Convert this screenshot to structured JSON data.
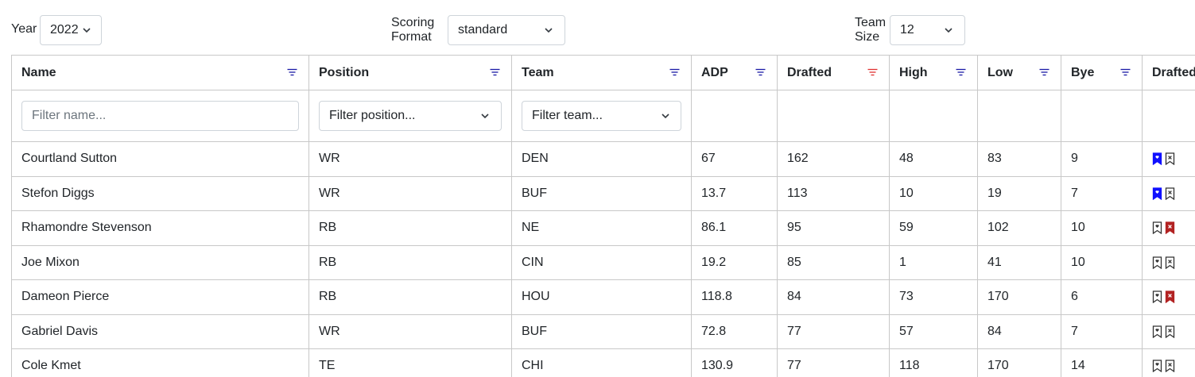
{
  "controls": {
    "year": {
      "label": "Year",
      "value": "2022"
    },
    "scoring": {
      "label_line1": "Scoring",
      "label_line2": "Format",
      "value": "standard"
    },
    "team_size": {
      "label_line1": "Team",
      "label_line2": "Size",
      "value": "12"
    }
  },
  "columns": [
    {
      "label": "Name",
      "filter_active": false
    },
    {
      "label": "Position",
      "filter_active": false
    },
    {
      "label": "Team",
      "filter_active": false
    },
    {
      "label": "ADP",
      "filter_active": false
    },
    {
      "label": "Drafted",
      "filter_active": true
    },
    {
      "label": "High",
      "filter_active": false
    },
    {
      "label": "Low",
      "filter_active": false
    },
    {
      "label": "Bye",
      "filter_active": false
    },
    {
      "label": "Drafted",
      "filter_active": false
    }
  ],
  "filters": {
    "name_placeholder": "Filter name...",
    "position_placeholder": "Filter position...",
    "team_placeholder": "Filter team..."
  },
  "colors": {
    "accent_blue": "#1010ff",
    "accent_red": "#b22222",
    "filter_icon": "#1a1aa6",
    "filter_icon_active": "#e03030"
  },
  "rows": [
    {
      "name": "Courtland Sutton",
      "position": "WR",
      "team": "DEN",
      "adp": "67",
      "drafted": "162",
      "high": "48",
      "low": "83",
      "bye": "9",
      "mark": "left"
    },
    {
      "name": "Stefon Diggs",
      "position": "WR",
      "team": "BUF",
      "adp": "13.7",
      "drafted": "113",
      "high": "10",
      "low": "19",
      "bye": "7",
      "mark": "left"
    },
    {
      "name": "Rhamondre Stevenson",
      "position": "RB",
      "team": "NE",
      "adp": "86.1",
      "drafted": "95",
      "high": "59",
      "low": "102",
      "bye": "10",
      "mark": "right"
    },
    {
      "name": "Joe Mixon",
      "position": "RB",
      "team": "CIN",
      "adp": "19.2",
      "drafted": "85",
      "high": "1",
      "low": "41",
      "bye": "10",
      "mark": "none"
    },
    {
      "name": "Dameon Pierce",
      "position": "RB",
      "team": "HOU",
      "adp": "118.8",
      "drafted": "84",
      "high": "73",
      "low": "170",
      "bye": "6",
      "mark": "right"
    },
    {
      "name": "Gabriel Davis",
      "position": "WR",
      "team": "BUF",
      "adp": "72.8",
      "drafted": "77",
      "high": "57",
      "low": "84",
      "bye": "7",
      "mark": "none"
    },
    {
      "name": "Cole Kmet",
      "position": "TE",
      "team": "CHI",
      "adp": "130.9",
      "drafted": "77",
      "high": "118",
      "low": "170",
      "bye": "14",
      "mark": "none"
    }
  ]
}
